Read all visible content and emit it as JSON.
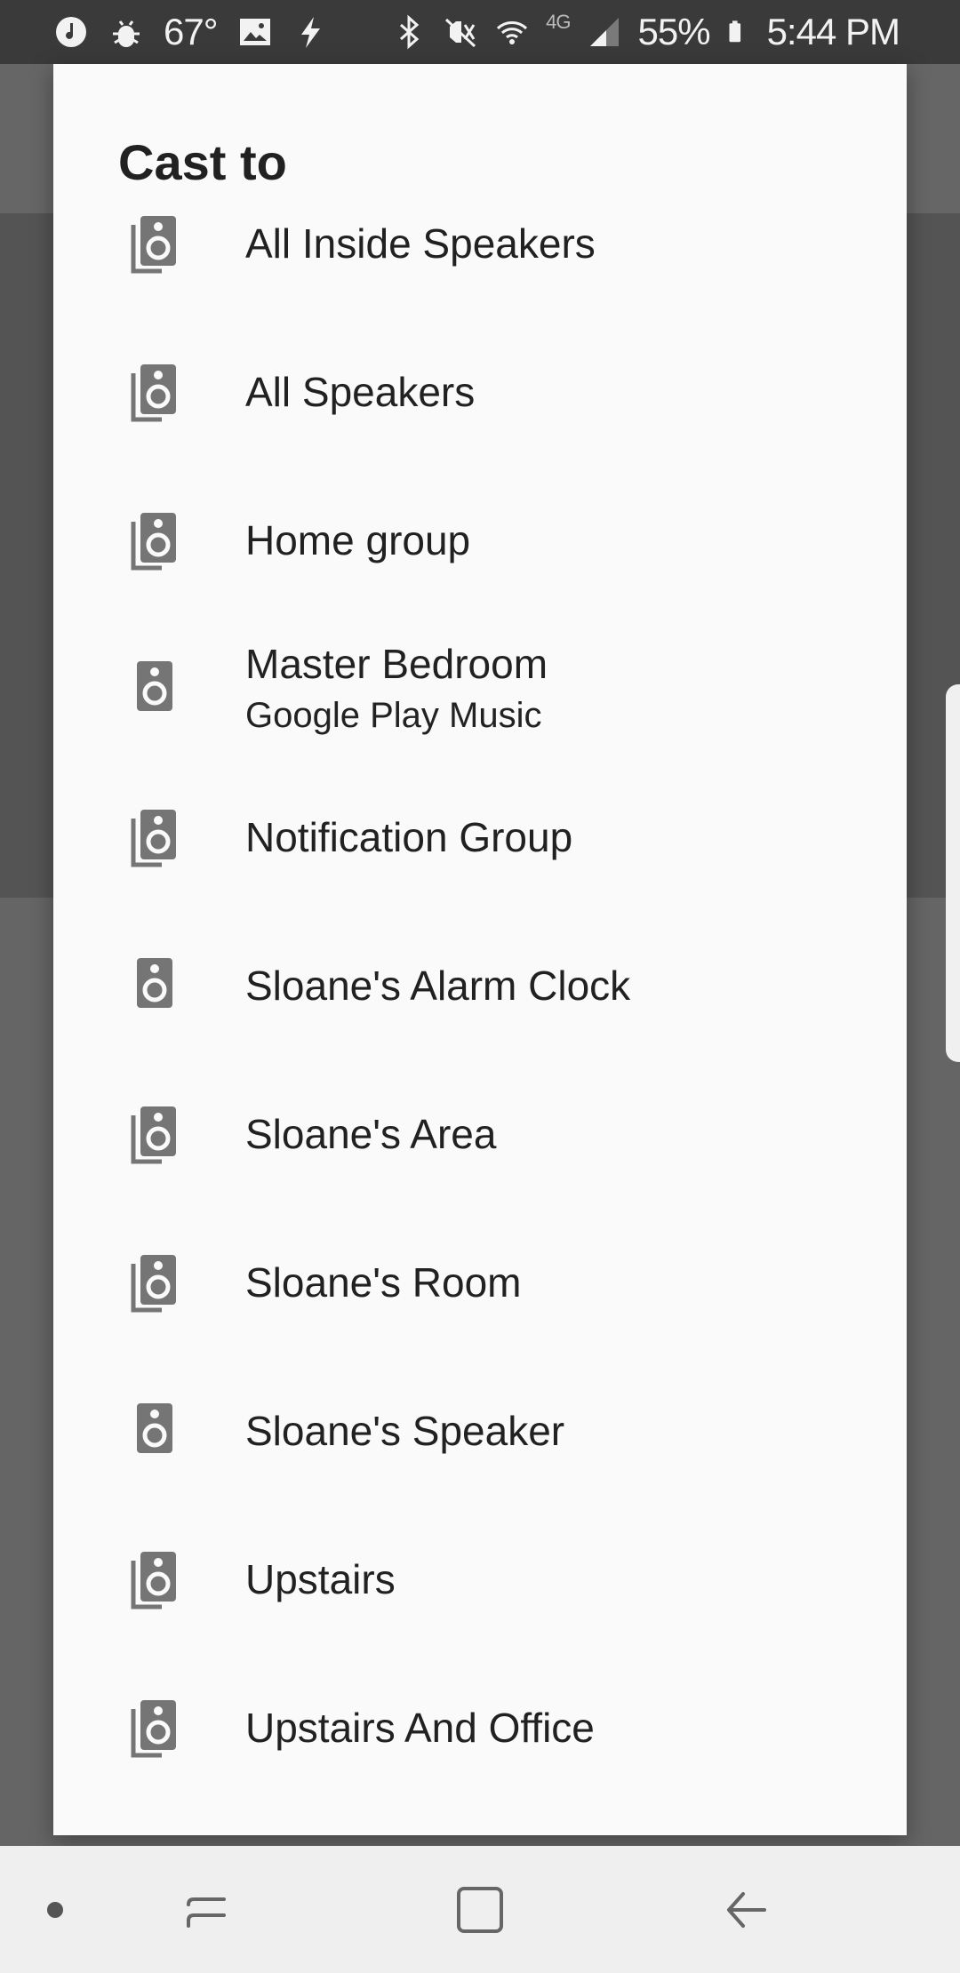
{
  "status_bar": {
    "left_icons": [
      "music-icon",
      "android-debug-icon",
      "image-icon",
      "flash-icon"
    ],
    "temperature": "67°",
    "right_icons": [
      "bluetooth-icon",
      "vibrate-mute-icon",
      "wifi-icon",
      "lte-icon",
      "signal-icon",
      "battery-icon"
    ],
    "network_type": "4G",
    "battery_percent": "55%",
    "time": "5:44 PM"
  },
  "dialog": {
    "title": "Cast to",
    "devices": [
      {
        "name": "All Inside Speakers",
        "subtitle": "",
        "icon": "speaker-group-icon"
      },
      {
        "name": "All Speakers",
        "subtitle": "",
        "icon": "speaker-group-icon"
      },
      {
        "name": "Home group",
        "subtitle": "",
        "icon": "speaker-group-icon"
      },
      {
        "name": "Master Bedroom",
        "subtitle": "Google Play Music",
        "icon": "speaker-icon"
      },
      {
        "name": "Notification Group",
        "subtitle": "",
        "icon": "speaker-group-icon"
      },
      {
        "name": "Sloane's Alarm Clock",
        "subtitle": "",
        "icon": "speaker-icon"
      },
      {
        "name": "Sloane's Area",
        "subtitle": "",
        "icon": "speaker-group-icon"
      },
      {
        "name": "Sloane's Room",
        "subtitle": "",
        "icon": "speaker-group-icon"
      },
      {
        "name": "Sloane's Speaker",
        "subtitle": "",
        "icon": "speaker-icon"
      },
      {
        "name": "Upstairs",
        "subtitle": "",
        "icon": "speaker-group-icon"
      },
      {
        "name": "Upstairs And Office",
        "subtitle": "",
        "icon": "speaker-group-icon"
      }
    ]
  },
  "nav_bar": {
    "buttons": [
      "dot-icon",
      "recents-icon",
      "home-icon",
      "back-icon"
    ]
  },
  "colors": {
    "dialog_bg": "#fafafa",
    "icon_gray": "#757575",
    "status_bar_bg": "#3a3a3a",
    "scrim": "#5e5e5e"
  }
}
